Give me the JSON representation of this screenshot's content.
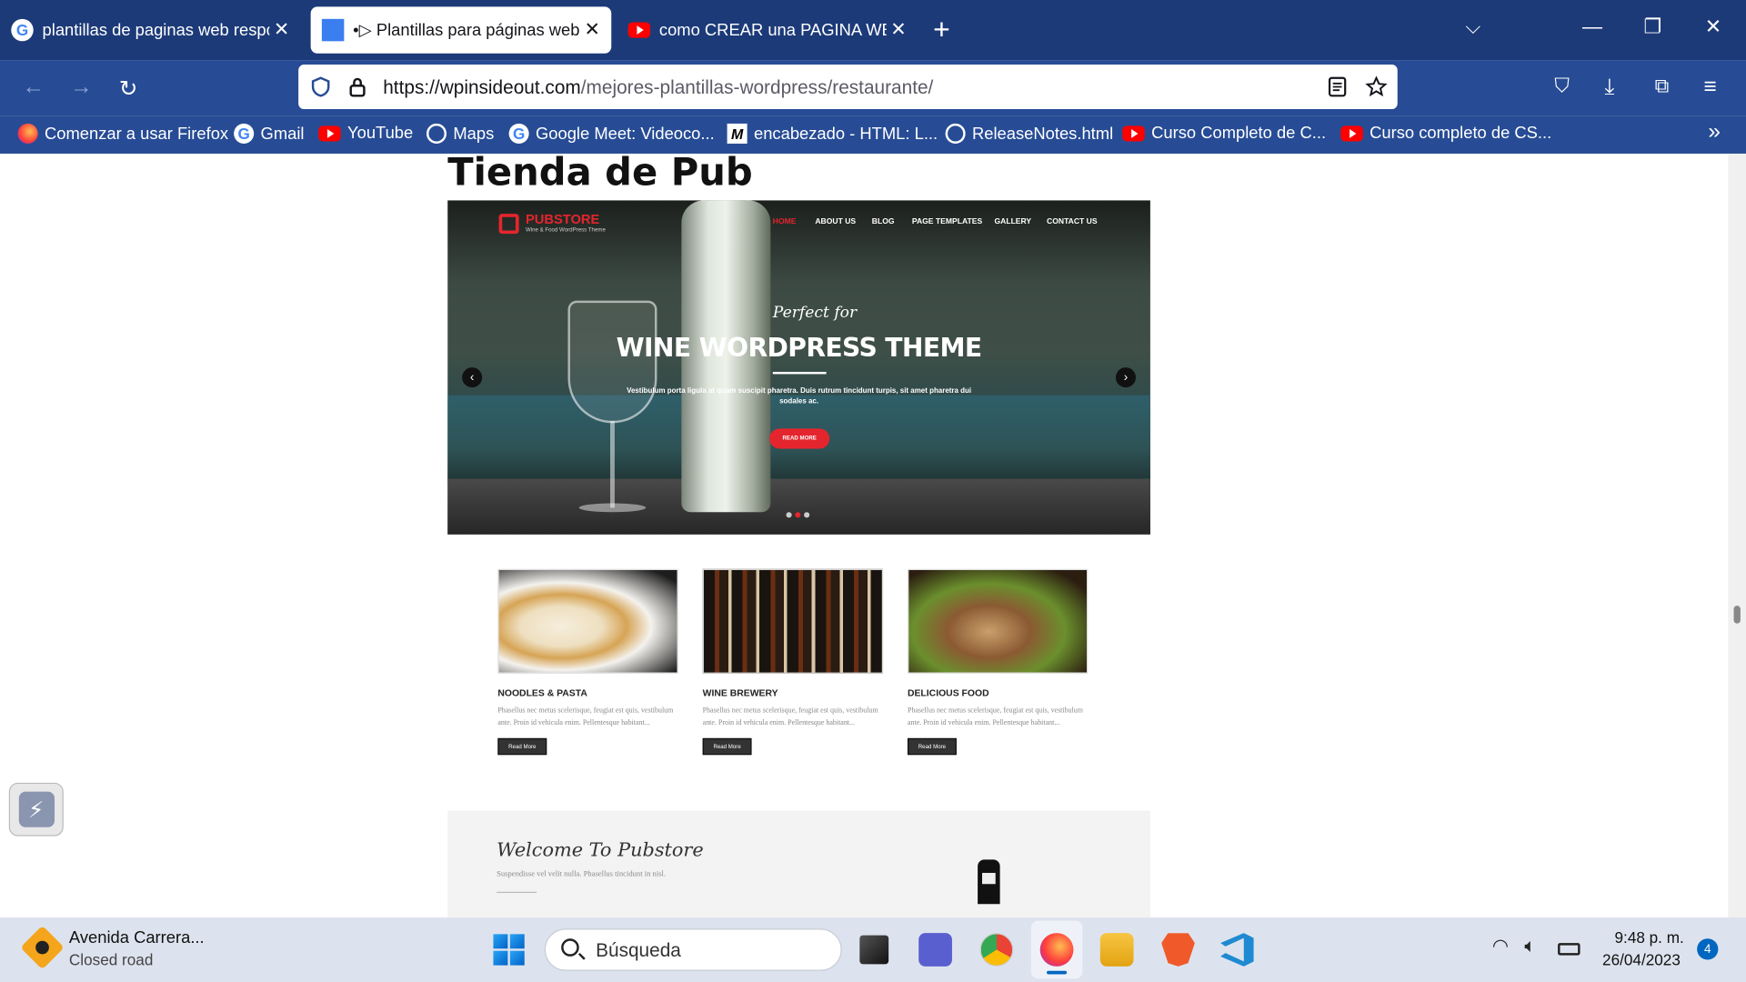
{
  "tabs": [
    {
      "title": "plantillas de paginas web respo",
      "icon": "google-icon"
    },
    {
      "title": "•▷ Plantillas para páginas web",
      "icon": "page-favicon-icon",
      "active": true
    },
    {
      "title": "como CREAR una PAGINA WEB",
      "icon": "youtube-icon"
    }
  ],
  "address": {
    "url_domain": "https://wpinsideout.com",
    "url_path": "/mejores-plantillas-wordpress/restaurante/"
  },
  "bookmarks": [
    {
      "label": "Comenzar a usar Firefox",
      "icon": "firefox-icon"
    },
    {
      "label": "Gmail",
      "icon": "google-icon"
    },
    {
      "label": "YouTube",
      "icon": "youtube-icon"
    },
    {
      "label": "Maps",
      "icon": "globe-icon"
    },
    {
      "label": "Google Meet: Videoco...",
      "icon": "google-icon"
    },
    {
      "label": "encabezado - HTML: L...",
      "icon": "mdn-icon"
    },
    {
      "label": "ReleaseNotes.html",
      "icon": "globe-icon"
    },
    {
      "label": "Curso Completo de C...",
      "icon": "youtube-icon"
    },
    {
      "label": "Curso completo de CS...",
      "icon": "youtube-icon"
    }
  ],
  "page": {
    "title": "Tienda de Pub",
    "hero": {
      "logo": "PUBSTORE",
      "logo_sub": "Wine & Food WordPress Theme",
      "nav": [
        "HOME",
        "ABOUT US",
        "BLOG",
        "PAGE TEMPLATES",
        "GALLERY",
        "CONTACT US"
      ],
      "kicker": "Perfect for",
      "headline": "WINE WORDPRESS THEME",
      "sub": "Vestibulum porta ligula at quam suscipit pharetra. Duis rutrum tincidunt turpis, sit amet pharetra dui sodales ac.",
      "button": "READ MORE"
    },
    "cards": [
      {
        "title": "NOODLES & PASTA",
        "text": "Phasellus nec metus scelerisque, feugiat est quis, vestibulum ante. Proin id vehicula enim. Pellentesque habitant...",
        "button": "Read More"
      },
      {
        "title": "WINE BREWERY",
        "text": "Phasellus nec metus scelerisque, feugiat est quis, vestibulum ante. Proin id vehicula enim. Pellentesque habitant...",
        "button": "Read More"
      },
      {
        "title": "DELICIOUS FOOD",
        "text": "Phasellus nec metus scelerisque, feugiat est quis, vestibulum ante. Proin id vehicula enim. Pellentesque habitant...",
        "button": "Read More"
      }
    ],
    "welcome": {
      "title": "Welcome To Pubstore",
      "sub": "Suspendisse vel velit nulla. Phasellus tincidunt in nisl."
    }
  },
  "taskbar": {
    "weather_line1": "Avenida Carrera...",
    "weather_line2": "Closed road",
    "search_placeholder": "Búsqueda",
    "time": "9:48 p. m.",
    "date": "26/04/2023",
    "notification_count": "4"
  },
  "colors": {
    "tabstrip": "#1c3a78",
    "toolbar": "#274c95",
    "accent": "#e4252d",
    "taskbar": "#dde3ee"
  }
}
